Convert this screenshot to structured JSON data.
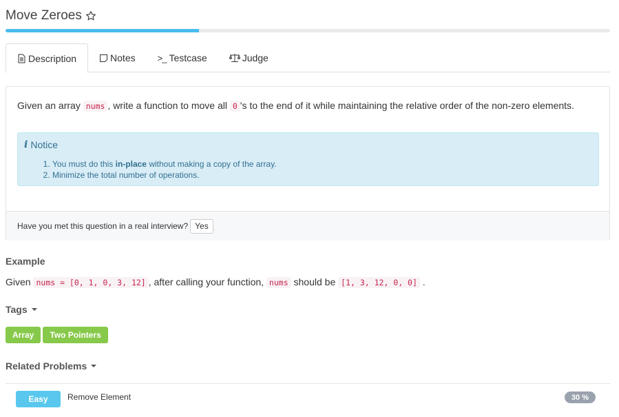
{
  "problem": {
    "title": "Move Zeroes",
    "progress_percent": 32
  },
  "tabs": [
    {
      "label": "Description",
      "icon": "document-icon"
    },
    {
      "label": "Notes",
      "icon": "note-icon"
    },
    {
      "label": "Testcase",
      "icon": "terminal-icon"
    },
    {
      "label": "Judge",
      "icon": "scale-icon"
    }
  ],
  "description": {
    "p1": "Given an array",
    "code1": "nums",
    "p2": ", write a function to move all",
    "code2": "0",
    "p3": "'s to the end of it while maintaining the relative order of the non-zero elements."
  },
  "notice": {
    "title": "Notice",
    "item1_before": "You must do this",
    "item1_bold": "in-place",
    "item1_after": "without making a copy of the array.",
    "item2": "Minimize the total number of operations."
  },
  "interview": {
    "question": "Have you met this question in a real interview?",
    "yes_label": "Yes"
  },
  "example": {
    "heading": "Example",
    "t1": "Given",
    "code1": "nums = [0, 1, 0, 3, 12]",
    "t2": ", after calling your function,",
    "code2": "nums",
    "t3": "should be",
    "code3": "[1, 3, 12, 0, 0]",
    "t4": "."
  },
  "tags": {
    "heading": "Tags",
    "items": [
      "Array",
      "Two Pointers"
    ]
  },
  "related": {
    "heading": "Related Problems",
    "items": [
      {
        "difficulty": "Easy",
        "title": "Remove Element",
        "percent": "30 %"
      }
    ]
  },
  "colors": {
    "progress": "#49bcee",
    "tag": "#87c94a",
    "easy": "#5ac8ee",
    "notice_bg": "#d9edf7",
    "notice_text": "#31708f",
    "code_text": "#c7254e"
  }
}
